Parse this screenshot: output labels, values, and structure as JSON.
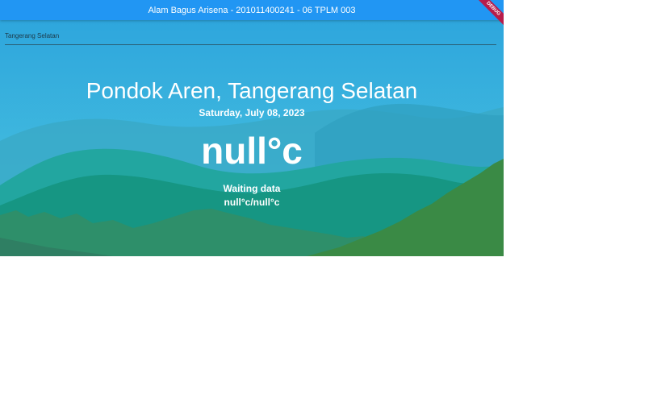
{
  "app": {
    "title": "Alam Bagus Arisena - 201011400241 - 06 TPLM 003",
    "debug_banner": "DEBUG"
  },
  "search": {
    "value": "Tangerang Selatan"
  },
  "weather": {
    "location": "Pondok Aren, Tangerang Selatan",
    "date": "Saturday, July 08, 2023",
    "temperature": "null°c",
    "description": "Waiting data",
    "min_max": "null°c/null°c"
  },
  "colors": {
    "appbar": "#2196f3",
    "sky": "#35b2dc",
    "debug_banner": "#b71c4b"
  }
}
